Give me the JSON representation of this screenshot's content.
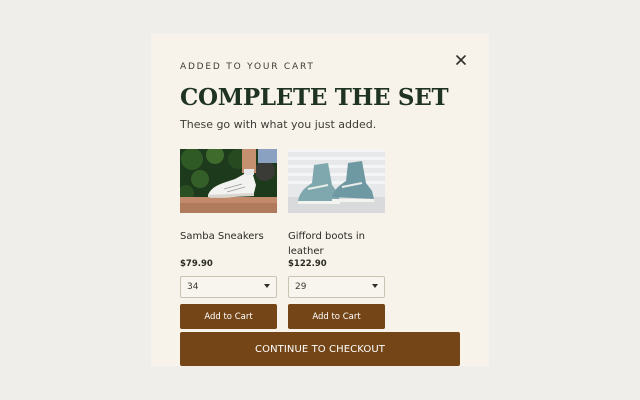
{
  "modal": {
    "eyebrow": "ADDED TO YOUR CART",
    "title": "COMPLETE THE SET",
    "subtitle": "These go with what you just added.",
    "close_icon": "close-icon"
  },
  "products": [
    {
      "name": "Samba Sneakers",
      "price": "$79.90",
      "size": "34",
      "add_label": "Add to Cart",
      "image_icon": "white-sneakers-photo"
    },
    {
      "name": "Gifford boots in leather",
      "price": "$122.90",
      "size": "29",
      "add_label": "Add to Cart",
      "image_icon": "blue-high-top-photo"
    }
  ],
  "checkout": {
    "label": "CONTINUE TO CHECKOUT"
  },
  "colors": {
    "background": "#efeeeb",
    "modal": "#f7f3ea",
    "title": "#1f3323",
    "button": "#744617"
  }
}
